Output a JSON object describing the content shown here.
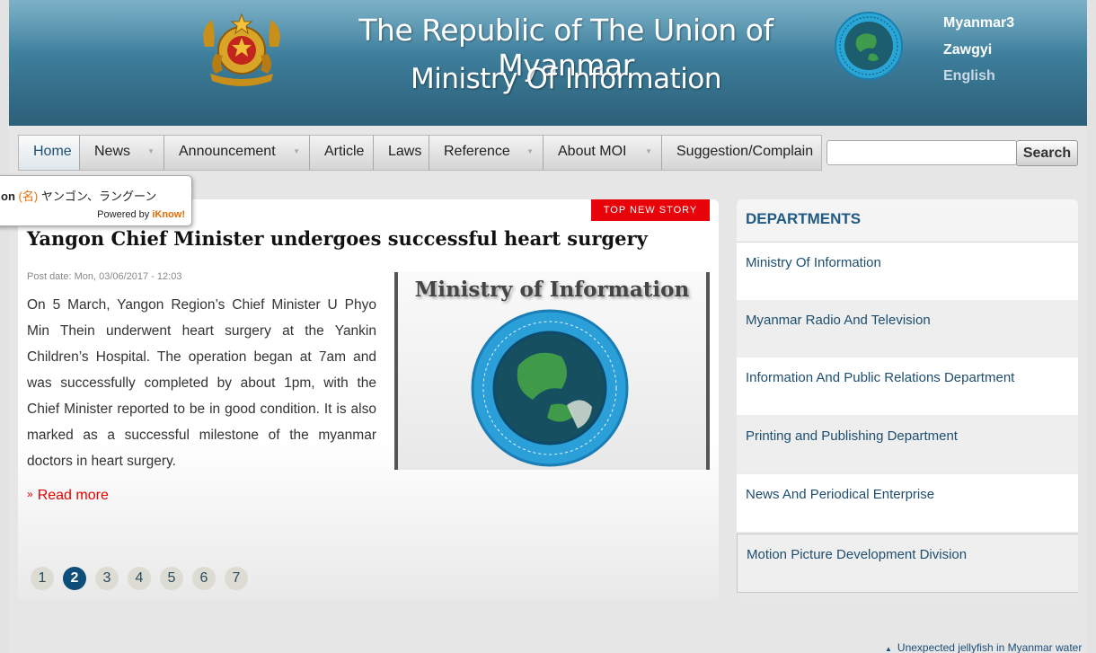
{
  "header": {
    "title_line1": "The Republic of The Union of Myanmar",
    "title_line2": "Ministry Of Information",
    "languages": [
      "Myanmar3",
      "Zawgyi",
      "English"
    ]
  },
  "nav": {
    "items": [
      {
        "label": "Home",
        "dropdown": false
      },
      {
        "label": "News",
        "dropdown": true
      },
      {
        "label": "Announcement",
        "dropdown": true
      },
      {
        "label": "Article",
        "dropdown": false
      },
      {
        "label": "Laws",
        "dropdown": false
      },
      {
        "label": "Reference",
        "dropdown": true
      },
      {
        "label": "About MOI",
        "dropdown": true
      },
      {
        "label": "Suggestion/Complain",
        "dropdown": false
      }
    ],
    "search_value": "",
    "search_button": "Search"
  },
  "popup": {
    "word_prefix": "on",
    "pos": "(名)",
    "translation": "ヤンゴン、ラングーン",
    "powered_by": "Powered by",
    "brand": "iKnow!"
  },
  "story": {
    "badge": "TOP NEW STORY",
    "headline": "Yangon Chief Minister undergoes successful heart surgery",
    "post_date": "Post date: Mon, 03/06/2017 - 12:03",
    "body": "On 5 March, Yangon Region’s Chief Minister U Phyo Min Thein underwent heart surgery at the Yankin Children’s Hospital. The operation began at 7am and was successfully completed by about 1pm, with the Chief Minister reported to be in good condition. It is also marked as a successful milestone of the myanmar doctors in heart surgery.",
    "image_caption": "Ministry of Information",
    "read_more": "Read more"
  },
  "pager": {
    "pages": [
      "1",
      "2",
      "3",
      "4",
      "5",
      "6",
      "7"
    ],
    "active": "2"
  },
  "sidebar": {
    "title": "DEPARTMENTS",
    "items": [
      "Ministry Of Information",
      "Myanmar Radio And Television",
      "Information And Public Relations Department",
      "Printing and Publishing Department",
      "News And Periodical Enterprise",
      "Motion Picture Development Division"
    ]
  },
  "footer": {
    "link": "Unexpected jellyfish in Myanmar water"
  },
  "colors": {
    "header_top": "#5fa0bb",
    "header_bottom": "#2c5f78",
    "link_blue": "#1e4e6f",
    "badge_red": "#e8030a",
    "read_more_red": "#e50000"
  }
}
